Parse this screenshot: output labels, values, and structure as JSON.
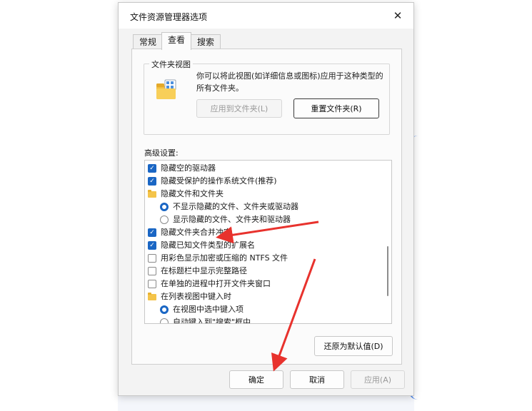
{
  "window": {
    "title": "文件资源管理器选项"
  },
  "tabs": [
    {
      "label": "常规"
    },
    {
      "label": "查看"
    },
    {
      "label": "搜索"
    }
  ],
  "folder_views": {
    "group_title": "文件夹视图",
    "description": "你可以将此视图(如详细信息或图标)应用于这种类型的所有文件夹。",
    "apply_button": "应用到文件夹(L)",
    "reset_button": "重置文件夹(R)"
  },
  "advanced": {
    "label": "高级设置:",
    "items": [
      {
        "text": "隐藏空的驱动器",
        "kind": "checkbox",
        "checked": true
      },
      {
        "text": "隐藏受保护的操作系统文件(推荐)",
        "kind": "checkbox",
        "checked": true
      },
      {
        "text": "隐藏文件和文件夹",
        "kind": "folder"
      },
      {
        "text": "不显示隐藏的文件、文件夹或驱动器",
        "kind": "radio",
        "checked": true
      },
      {
        "text": "显示隐藏的文件、文件夹和驱动器",
        "kind": "radio",
        "checked": false
      },
      {
        "text": "隐藏文件夹合并冲突",
        "kind": "checkbox",
        "checked": true
      },
      {
        "text": "隐藏已知文件类型的扩展名",
        "kind": "checkbox",
        "checked": true
      },
      {
        "text": "用彩色显示加密或压缩的 NTFS 文件",
        "kind": "checkbox",
        "checked": false
      },
      {
        "text": "在标题栏中显示完整路径",
        "kind": "checkbox",
        "checked": false
      },
      {
        "text": "在单独的进程中打开文件夹窗口",
        "kind": "checkbox",
        "checked": false
      },
      {
        "text": "在列表视图中键入时",
        "kind": "folder"
      },
      {
        "text": "在视图中选中键入项",
        "kind": "radio",
        "checked": true
      },
      {
        "text": "自动键入到\"搜索\"框中",
        "kind": "radio",
        "checked": false
      }
    ],
    "restore_button": "还原为默认值(D)"
  },
  "footer": {
    "ok": "确定",
    "cancel": "取消",
    "apply": "应用(A)"
  },
  "colors": {
    "accent": "#1a66c4",
    "annotation_arrow": "#e8322d"
  }
}
